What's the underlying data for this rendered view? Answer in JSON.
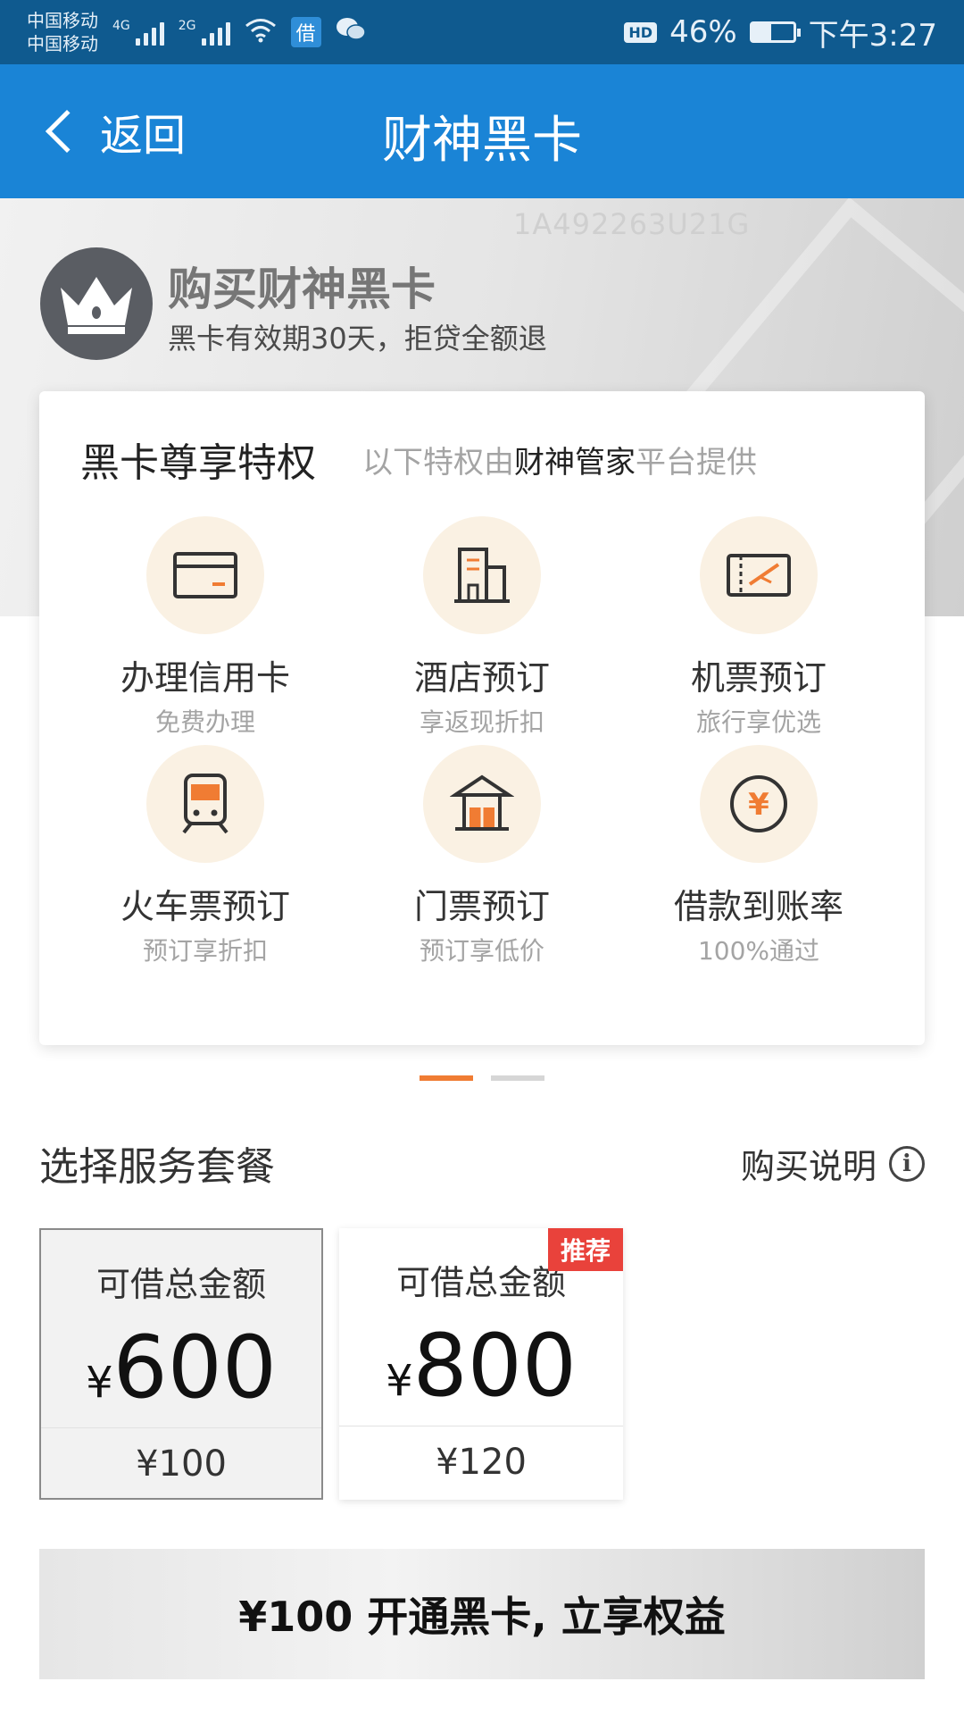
{
  "status_bar": {
    "carrier_top": "中国移动",
    "carrier_bottom": "中国移动",
    "network_1": "4G",
    "network_2": "2G",
    "app_badge": "借",
    "hd": "HD",
    "battery_percent": "46%",
    "battery_level": 0.46,
    "time": "下午3:27"
  },
  "nav": {
    "back_label": "返回",
    "title": "财神黑卡"
  },
  "hero": {
    "watermark": "1A492263U21G",
    "title": "购买财神黑卡",
    "subtitle": "黑卡有效期30天，拒贷全额退"
  },
  "privileges": {
    "title": "黑卡尊享特权",
    "provider_prefix": "以下特权由",
    "provider_brand": "财神管家",
    "provider_suffix": "平台提供",
    "items": [
      {
        "icon": "credit-card-icon",
        "label": "办理信用卡",
        "desc": "免费办理"
      },
      {
        "icon": "hotel-icon",
        "label": "酒店预订",
        "desc": "享返现折扣"
      },
      {
        "icon": "plane-ticket-icon",
        "label": "机票预订",
        "desc": "旅行享优选"
      },
      {
        "icon": "train-icon",
        "label": "火车票预订",
        "desc": "预订享折扣"
      },
      {
        "icon": "pavilion-icon",
        "label": "门票预订",
        "desc": "预订享低价"
      },
      {
        "icon": "yen-coin-icon",
        "label": "借款到账率",
        "desc": "100%通过"
      }
    ]
  },
  "packages": {
    "title": "选择服务套餐",
    "instructions": "购买说明",
    "items": [
      {
        "label": "可借总金额",
        "currency": "¥",
        "amount": "600",
        "price": "¥100",
        "badge": ""
      },
      {
        "label": "可借总金额",
        "currency": "¥",
        "amount": "800",
        "price": "¥120",
        "badge": "推荐"
      }
    ]
  },
  "cta": {
    "label": "¥100 开通黑卡, 立享权益"
  },
  "colors": {
    "status_bar": "#0f5a8f",
    "nav_bar": "#1a84d6",
    "accent_orange": "#f07c33",
    "badge_red": "#e9423b",
    "icon_bg": "#faf1e3"
  }
}
